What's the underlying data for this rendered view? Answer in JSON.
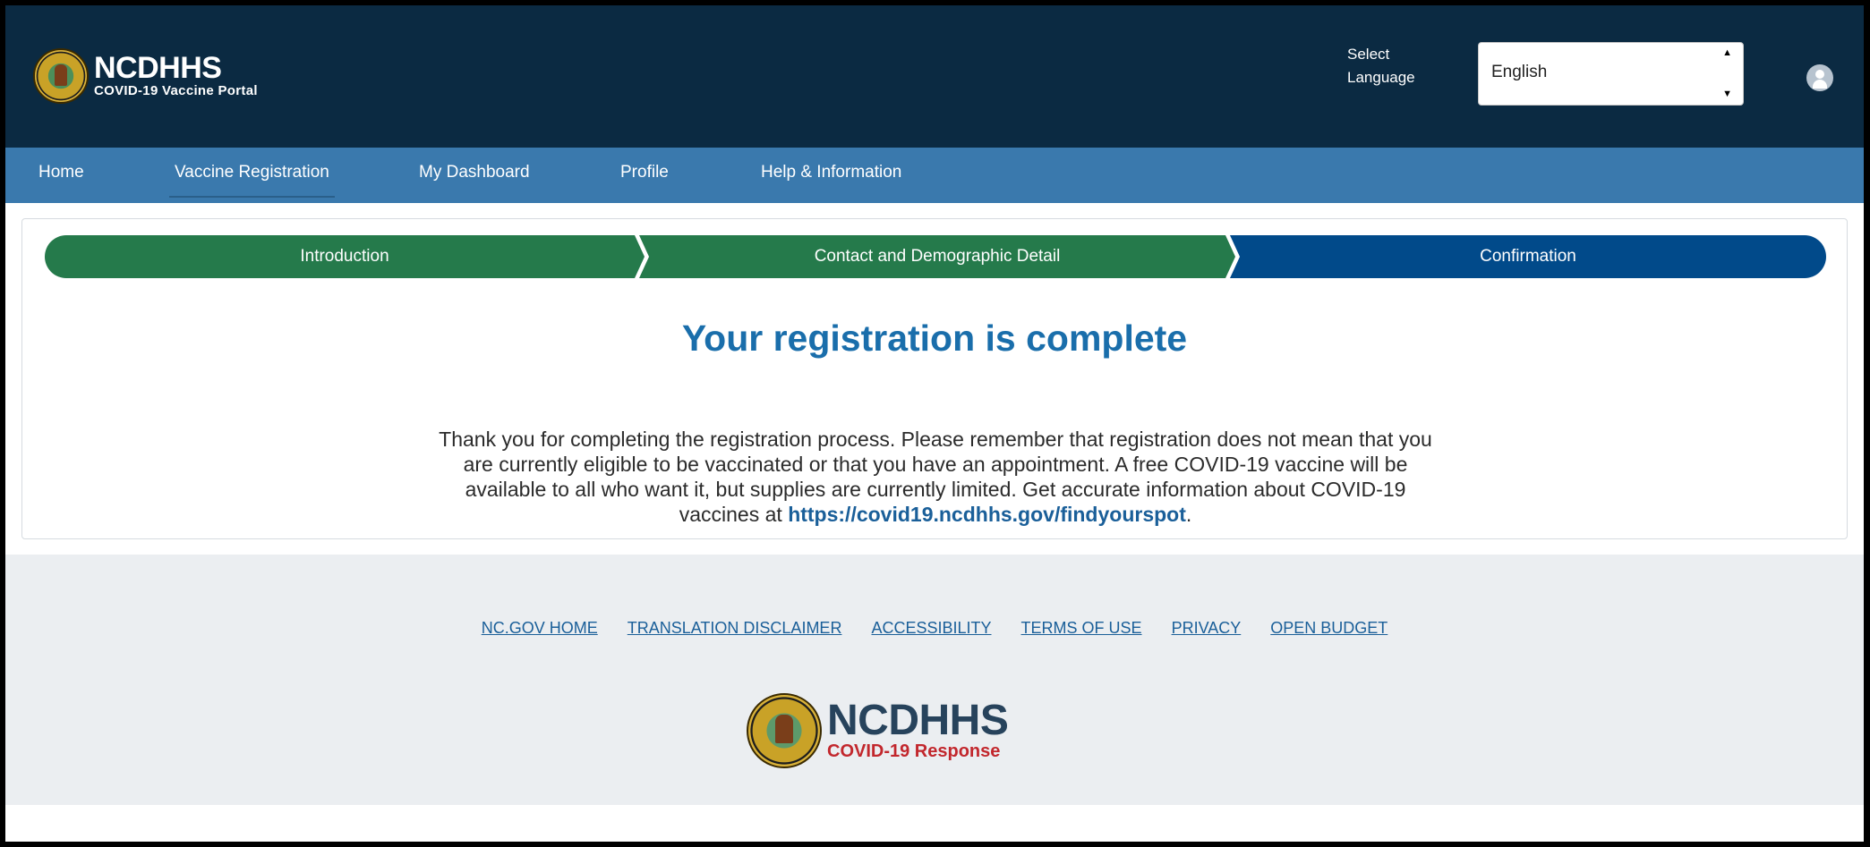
{
  "header": {
    "brand_name": "NCDHHS",
    "brand_subtitle": "COVID-19 Vaccine Portal",
    "language_label": "Select Language",
    "language_value": "English"
  },
  "nav": {
    "items": [
      {
        "label": "Home"
      },
      {
        "label": "Vaccine Registration"
      },
      {
        "label": "My Dashboard"
      },
      {
        "label": "Profile"
      },
      {
        "label": "Help & Information"
      }
    ],
    "active": "Vaccine Registration"
  },
  "steps": [
    {
      "label": "Introduction",
      "status": "complete",
      "color": "#257a4b"
    },
    {
      "label": "Contact and Demographic Detail",
      "status": "complete",
      "color": "#257a4b"
    },
    {
      "label": "Confirmation",
      "status": "current",
      "color": "#014a8a"
    }
  ],
  "main": {
    "title": "Your registration is complete",
    "message": "Thank you for completing the registration process. Please remember that registration does not mean that you are currently eligible to be vaccinated or that you have an appointment. A free COVID-19 vaccine will be available to all who want it, but supplies are currently limited. Get accurate information about COVID-19 vaccines at ",
    "link_text": "https://covid19.ncdhhs.gov/findyourspot",
    "message_end": "."
  },
  "footer": {
    "links": [
      {
        "label": "NC.GOV HOME"
      },
      {
        "label": "TRANSLATION DISCLAIMER"
      },
      {
        "label": "ACCESSIBILITY"
      },
      {
        "label": "TERMS OF USE"
      },
      {
        "label": "PRIVACY"
      },
      {
        "label": "OPEN BUDGET"
      }
    ],
    "logo_name": "NCDHHS",
    "logo_subtitle": "COVID-19 Response"
  },
  "colors": {
    "header_bg": "#0b2a42",
    "nav_bg": "#3a79ad",
    "title_blue": "#1a6eab",
    "step_complete": "#257a4b",
    "step_current": "#014a8a",
    "footer_text": "#c2272d"
  },
  "icons": {
    "header_logo": "nc-seal-icon",
    "user": "user-avatar-icon",
    "footer_logo": "nc-seal-icon"
  }
}
